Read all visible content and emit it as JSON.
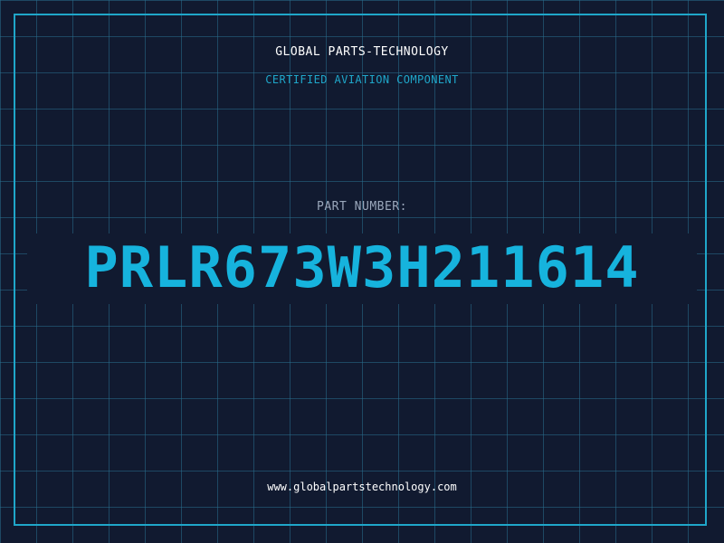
{
  "header": {
    "company": "GLOBAL PARTS-TECHNOLOGY",
    "tagline": "CERTIFIED AVIATION COMPONENT"
  },
  "part": {
    "label": "PART NUMBER:",
    "number": "PRLR673W3H211614"
  },
  "footer": {
    "website": "www.globalpartstechnology.com"
  },
  "colors": {
    "background": "#111a30",
    "grid": "#286e8c",
    "accent": "#1fa6c9",
    "part_number": "#16b3dd",
    "label": "#9aa7bb",
    "text": "#ffffff"
  }
}
